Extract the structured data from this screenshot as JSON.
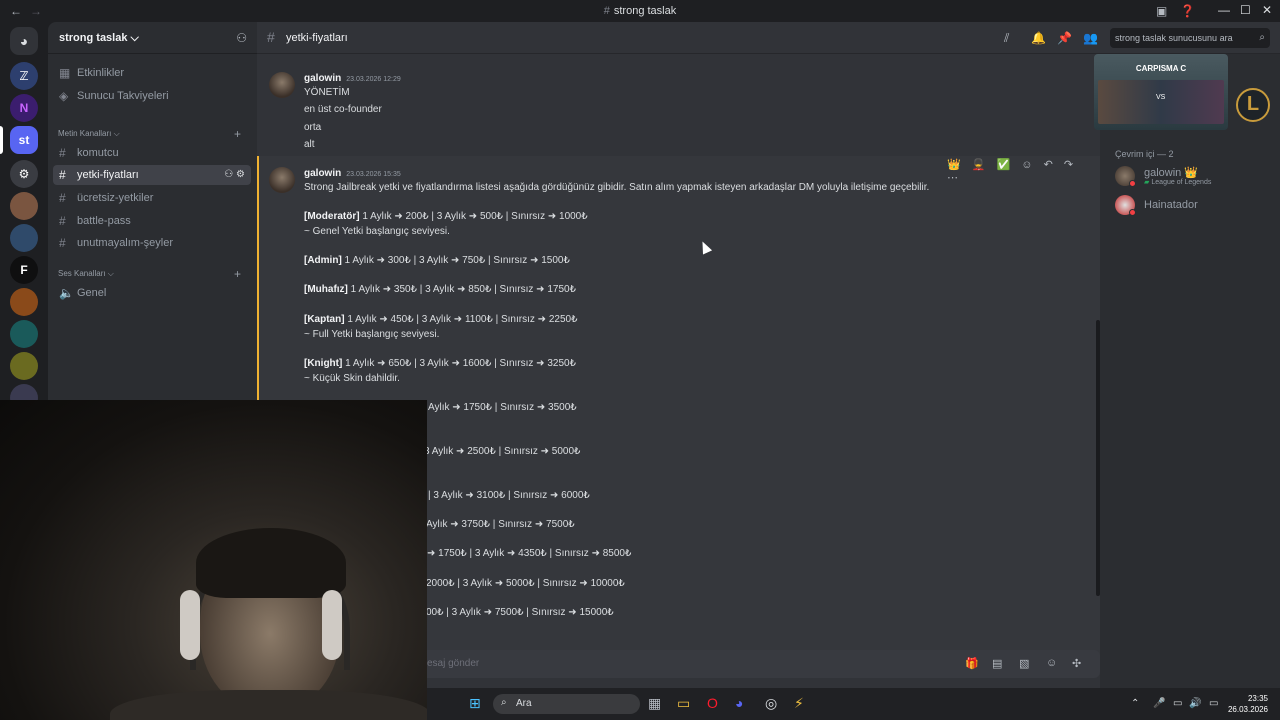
{
  "window": {
    "title": "strong taslak",
    "title_hash": "#"
  },
  "server": {
    "name": "strong taslak",
    "name_suffix": "⌵",
    "current_guild_label": "st",
    "guild_letters": [
      "N",
      "F"
    ]
  },
  "sidebar": {
    "top_items": [
      {
        "label": "Etkinlikler",
        "icon": "calendar-icon"
      },
      {
        "label": "Sunucu Takviyeleri",
        "icon": "boost-icon"
      }
    ],
    "text_category": "Metin Kanalları ⌵",
    "text_channels": [
      "komutcu",
      "yetki-fiyatları",
      "ücretsiz-yetkiler",
      "battle-pass",
      "unutmayalım-şeyler"
    ],
    "voice_category": "Ses Kanalları ⌵",
    "voice_channels": [
      "Genel"
    ]
  },
  "channel": {
    "name": "yetki-fiyatları",
    "search_placeholder": "strong taslak sunucusunu ara"
  },
  "messages": [
    {
      "author": "galowin",
      "timestamp": "23.03.2026 12:29",
      "lines": [
        "YÖNETİM",
        "en üst co-founder",
        "orta",
        "alt"
      ]
    },
    {
      "author": "galowin",
      "timestamp": "23.03.2026 15:35",
      "intro": "Strong Jailbreak yetki ve fiyatlandırma listesi aşağıda gördüğünüz gibidir. Satın alım yapmak isteyen arkadaşlar DM yoluyla iletişime geçebilir.",
      "tiers": [
        {
          "rank": "[Moderatör]",
          "prices": " 1 Aylık ➜ 200₺ | 3 Aylık ➜ 500₺ | Sınırsız ➜ 1000₺",
          "note": "~ Genel Yetki başlangıç seviyesi."
        },
        {
          "rank": "[Admin]",
          "prices": " 1 Aylık ➜ 300₺ | 3 Aylık ➜ 750₺ | Sınırsız ➜ 1500₺"
        },
        {
          "rank": "[Muhafız]",
          "prices": " 1 Aylık ➜ 350₺ | 3 Aylık ➜ 850₺ | Sınırsız ➜ 1750₺"
        },
        {
          "rank": "[Kaptan]",
          "prices": " 1 Aylık ➜ 450₺ | 3 Aylık ➜ 1100₺ | Sınırsız ➜ 2250₺",
          "note": "~ Full Yetki başlangıç seviyesi."
        },
        {
          "rank": "[Knight]",
          "prices": " 1 Aylık ➜ 650₺ | 3 Aylık ➜ 1600₺ | Sınırsız ➜ 3250₺",
          "note": "~ Küçük Skin dahildir."
        }
      ],
      "partial_lines": [
        "Aylık ➜ 1750₺ | Sınırsız ➜ 3500₺",
        "3 Aylık ➜ 2500₺ | Sınırsız ➜ 5000₺",
        "| 3 Aylık ➜ 3100₺ | Sınırsız ➜ 6000₺",
        "Aylık ➜ 3750₺ | Sınırsız ➜ 7500₺",
        "➜ 1750₺ | 3 Aylık ➜ 4350₺ | Sınırsız ➜ 8500₺",
        "2000₺ | 3 Aylık ➜ 5000₺ | Sınırsız ➜ 10000₺",
        "00₺ | 3 Aylık ➜ 7500₺ | Sınırsız ➜ 15000₺"
      ],
      "reactions": [
        "👑",
        "💂",
        "✅"
      ]
    }
  ],
  "composer": {
    "placeholder_partial": "esaj gönder"
  },
  "members": {
    "banner_title": "CARPISMA C",
    "banner_vs": "VS",
    "online_header": "Çevrim içi — 2",
    "list": [
      {
        "name": "galowin",
        "badge": "👑",
        "activity": "League of Legends"
      },
      {
        "name": "Hainatador"
      }
    ]
  },
  "taskbar": {
    "search_label": "Ara",
    "time": "23:35",
    "date": "26.03.2026"
  },
  "colors": {
    "background": "#313338",
    "sidebar": "#2b2d31",
    "highlight_bar": "#f0b232",
    "accent": "#5865f2",
    "dnd_status": "#f23f43"
  }
}
